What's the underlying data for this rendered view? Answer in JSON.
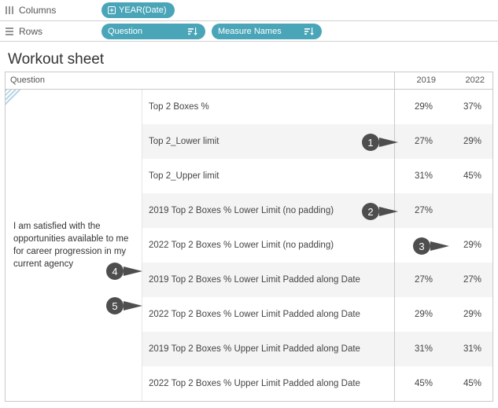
{
  "shelves": {
    "columns_label": "Columns",
    "rows_label": "Rows",
    "columns_pills": [
      {
        "label": "YEAR(Date)",
        "icon": "plus"
      }
    ],
    "rows_pills": [
      {
        "label": "Question",
        "icon": "",
        "sort": true
      },
      {
        "label": "Measure Names",
        "icon": "",
        "sort": true
      }
    ]
  },
  "sheet": {
    "title": "Workout sheet",
    "question_header": "Question",
    "year_headers": [
      "2019",
      "2022"
    ],
    "row_header_text": "I am satisfied with the opportunities available to me for career progression in my current agency",
    "measures": [
      {
        "name": "Top 2 Boxes %",
        "v2019": "29%",
        "v2022": "37%"
      },
      {
        "name": "Top 2_Lower limit",
        "v2019": "27%",
        "v2022": "29%"
      },
      {
        "name": "Top 2_Upper limit",
        "v2019": "31%",
        "v2022": "45%"
      },
      {
        "name": "2019 Top 2 Boxes %  Lower Limit (no padding)",
        "v2019": "27%",
        "v2022": ""
      },
      {
        "name": "2022 Top 2 Boxes %  Lower Limit (no padding)",
        "v2019": "",
        "v2022": "29%"
      },
      {
        "name": "2019 Top 2 Boxes %  Lower Limit Padded along Date",
        "v2019": "27%",
        "v2022": "27%"
      },
      {
        "name": "2022 Top 2 Boxes %  Lower Limit Padded along Date",
        "v2019": "29%",
        "v2022": "29%"
      },
      {
        "name": "2019 Top 2 Boxes %  Upper Limit Padded along Date",
        "v2019": "31%",
        "v2022": "31%"
      },
      {
        "name": "2022 Top 2 Boxes %  Upper Limit Padded along Date",
        "v2019": "45%",
        "v2022": "45%"
      }
    ]
  },
  "callouts": [
    "1",
    "2",
    "3",
    "4",
    "5"
  ]
}
